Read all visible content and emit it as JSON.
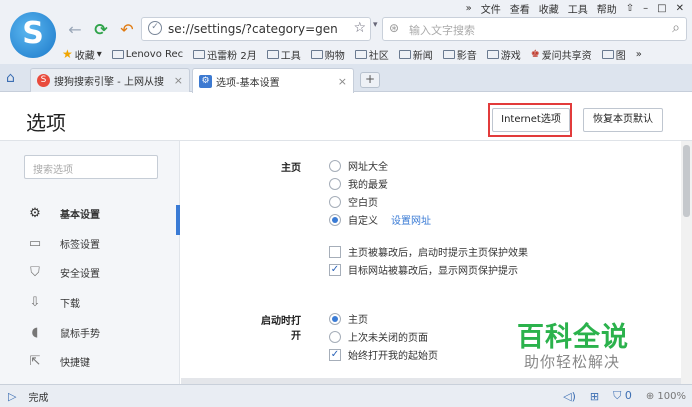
{
  "browser": {
    "logo_letter": "S",
    "address": "se://settings/?category=gen",
    "search_placeholder": "输入文字搜索",
    "top_menu": [
      "»",
      "文件",
      "查看",
      "收藏",
      "工具",
      "帮助",
      "⇧",
      "–",
      "□",
      "✕"
    ],
    "bookmarks": [
      "收藏",
      "Lenovo Rec",
      "迅雷粉 2月",
      "工具",
      "购物",
      "社区",
      "新闻",
      "影音",
      "游戏",
      "爱问共享资",
      "图",
      "»"
    ]
  },
  "tabs": [
    {
      "label": "搜狗搜索引擎 - 上网从搜",
      "favicon": "S"
    },
    {
      "label": "选项-基本设置",
      "favicon": "⚙"
    }
  ],
  "newtab_label": "+",
  "page": {
    "title": "选项",
    "ie_button": "Internet选项",
    "reset_button": "恢复本页默认",
    "search_placeholder": "搜索选项"
  },
  "sidebar": [
    {
      "label": "基本设置",
      "icon": "⚙",
      "active": true
    },
    {
      "label": "标签设置",
      "icon": "▭"
    },
    {
      "label": "安全设置",
      "icon": "⛉"
    },
    {
      "label": "下载",
      "icon": "⇩"
    },
    {
      "label": "鼠标手势",
      "icon": "◖"
    },
    {
      "label": "快捷键",
      "icon": "⇱"
    }
  ],
  "homepage": {
    "label": "主页",
    "options": [
      "网址大全",
      "我的最爱",
      "空白页",
      "自定义"
    ],
    "selected_index": 3,
    "set_link": "设置网址",
    "checks": [
      {
        "label": "主页被篡改后，启动时提示主页保护效果",
        "checked": false
      },
      {
        "label": "目标网站被篡改后，显示网页保护提示",
        "checked": true
      }
    ]
  },
  "startup": {
    "label": "启动时打开",
    "options": [
      "主页",
      "上次未关闭的页面"
    ],
    "selected_index": 0,
    "check": {
      "label": "始终打开我的起始页",
      "checked": true
    }
  },
  "watermark": {
    "title": "百科全说",
    "subtitle": "助你轻松解决"
  },
  "status": {
    "text": "完成",
    "zoom": "100%",
    "shield_count": "0"
  },
  "colors": {
    "accent": "#3a7bd5",
    "highlight": "#e23b3b",
    "watermark": "#2bb24c"
  }
}
